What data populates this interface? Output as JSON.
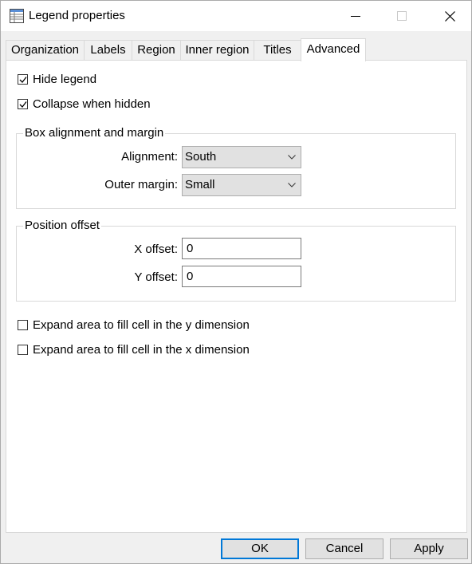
{
  "window": {
    "title": "Legend properties",
    "icon": "table-window-icon"
  },
  "tabs": [
    {
      "label": "Organization",
      "active": false
    },
    {
      "label": "Labels",
      "active": false
    },
    {
      "label": "Region",
      "active": false
    },
    {
      "label": "Inner region",
      "active": false
    },
    {
      "label": "Titles",
      "active": false
    },
    {
      "label": "Advanced",
      "active": true
    }
  ],
  "advanced": {
    "hide_legend": {
      "label": "Hide legend",
      "checked": true
    },
    "collapse_when_hidden": {
      "label": "Collapse when hidden",
      "checked": true
    },
    "box_alignment": {
      "title": "Box alignment and margin",
      "alignment_label": "Alignment:",
      "alignment_value": "South",
      "outer_margin_label": "Outer margin:",
      "outer_margin_value": "Small"
    },
    "position_offset": {
      "title": "Position offset",
      "x_label": "X offset:",
      "x_value": "0",
      "y_label": "Y offset:",
      "y_value": "0"
    },
    "expand_y": {
      "label": "Expand area to fill cell in the y dimension",
      "checked": false
    },
    "expand_x": {
      "label": "Expand area to fill cell in the x dimension",
      "checked": false
    }
  },
  "buttons": {
    "ok": "OK",
    "cancel": "Cancel",
    "apply": "Apply"
  },
  "colors": {
    "accent": "#0078d7",
    "button_face": "#e1e1e1",
    "dialog_bg": "#f0f0f0"
  }
}
